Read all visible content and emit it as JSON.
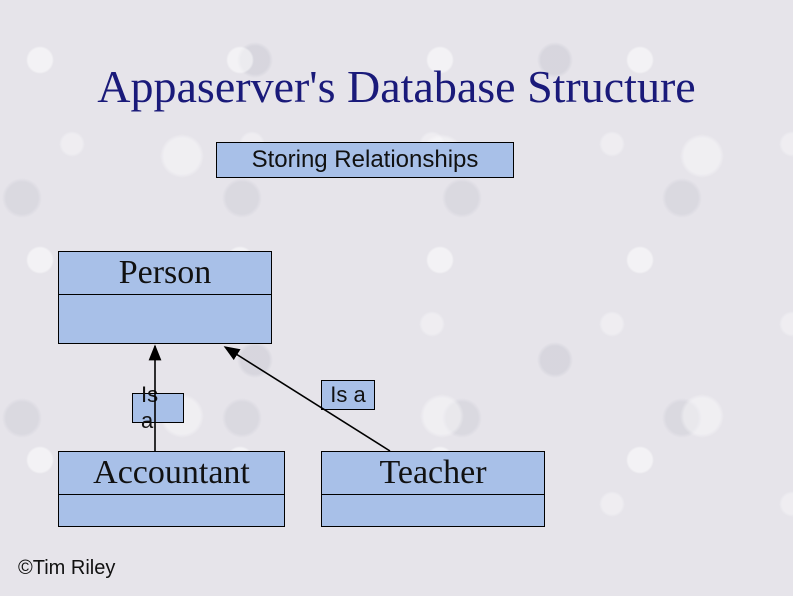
{
  "title": "Appaserver's Database Structure",
  "subtitle": "Storing Relationships",
  "entities": {
    "person": "Person",
    "accountant": "Accountant",
    "teacher": "Teacher"
  },
  "relationships": {
    "accountant_person": "Is a",
    "teacher_person": "Is a"
  },
  "copyright": "©Tim Riley",
  "colors": {
    "title": "#1a1a7a",
    "box_fill": "#a8c0e8",
    "box_border": "#000000"
  }
}
